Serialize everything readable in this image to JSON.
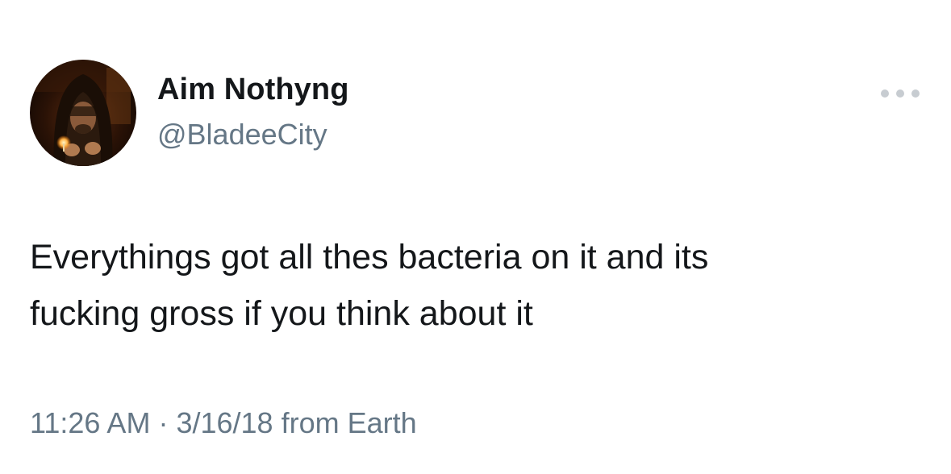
{
  "tweet": {
    "author": {
      "display_name": "Aim Nothyng",
      "handle": "@BladeeCity"
    },
    "text_line1": "Everythings got all thes bacteria on it and its",
    "text_line2": "fucking gross if you think about it",
    "time": "11:26 AM",
    "separator": "·",
    "date": "3/16/18",
    "source": "from Earth",
    "more_icon": "more-dots-icon"
  },
  "colors": {
    "text_primary": "#14171a",
    "text_secondary": "#657786",
    "dots": "#c7ccd1",
    "background": "#ffffff"
  }
}
